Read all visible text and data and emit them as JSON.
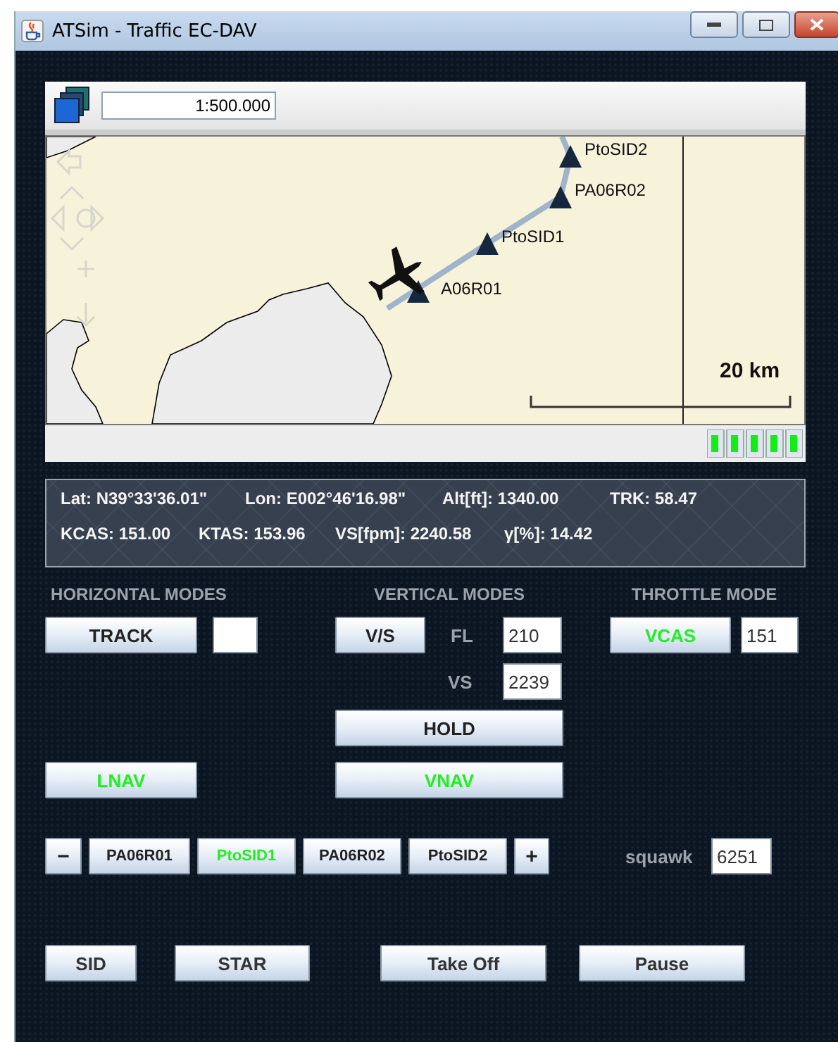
{
  "window": {
    "title": "ATSim - Traffic EC-DAV"
  },
  "map_toolbar": {
    "scale": "1:500.000"
  },
  "map": {
    "waypoints": [
      {
        "label": "PtoSID2"
      },
      {
        "label": "PA06R02"
      },
      {
        "label": "PtoSID1"
      },
      {
        "label": "A06R01"
      }
    ],
    "scale_label": "20 km"
  },
  "info": {
    "items": [
      "Lat: N39°33'36.01\"",
      "Lon: E002°46'16.98\"",
      "Alt[ft]: 1340.00",
      "TRK: 58.47",
      "KCAS: 151.00",
      "KTAS: 153.96",
      "VS[fpm]: 2240.58",
      "γ[%]: 14.42"
    ]
  },
  "horizontal": {
    "title": "HORIZONTAL MODES",
    "track": {
      "label": "TRACK",
      "active": false
    },
    "lnav": {
      "label": "LNAV",
      "active": true
    }
  },
  "vertical": {
    "title": "VERTICAL MODES",
    "vs_button": {
      "label": "V/S",
      "active": false
    },
    "fl_label": "FL",
    "fl_value": "210",
    "vs_label": "VS",
    "vs_value": "2239",
    "hold": {
      "label": "HOLD",
      "active": false
    },
    "vnav": {
      "label": "VNAV",
      "active": true
    }
  },
  "throttle": {
    "title": "THROTTLE MODE",
    "vcas": {
      "label": "VCAS",
      "active": true
    },
    "value": "151"
  },
  "route": {
    "minus": "−",
    "plus": "+",
    "waypoints": [
      {
        "label": "PA06R01",
        "active": false
      },
      {
        "label": "PtoSID1",
        "active": true
      },
      {
        "label": "PA06R02",
        "active": false
      },
      {
        "label": "PtoSID2",
        "active": false
      }
    ],
    "squawk_label": "squawk",
    "squawk_value": "6251"
  },
  "actions": [
    "SID",
    "STAR",
    "Take Off",
    "Pause"
  ]
}
